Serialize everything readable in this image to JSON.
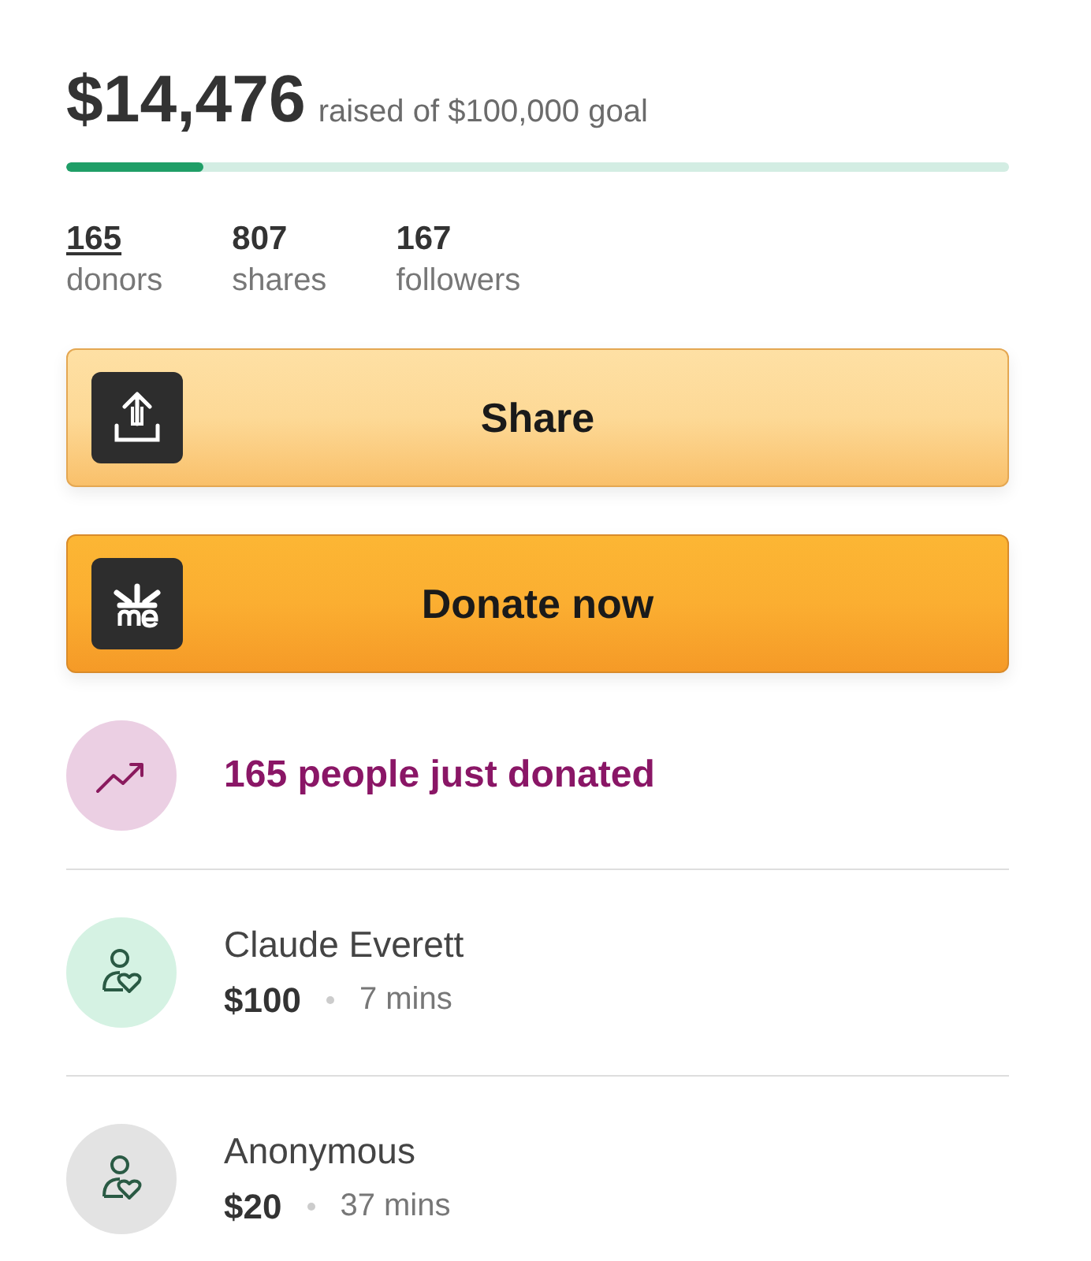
{
  "raised": {
    "amount": "$14,476",
    "caption": "raised of $100,000 goal",
    "level": 0.145
  },
  "stats": [
    {
      "value": "165",
      "label": "donors",
      "link": true
    },
    {
      "value": "807",
      "label": "shares",
      "link": false
    },
    {
      "value": "167",
      "label": "followers",
      "link": false
    }
  ],
  "buttons": [
    {
      "kind": "share",
      "label": "Share"
    },
    {
      "kind": "donate",
      "label": "Donate now"
    }
  ],
  "activity": {
    "text": "165 people just donated"
  },
  "donations": [
    {
      "name": "Claude Everett",
      "amount": "$100",
      "time": "7 mins",
      "color": "#d5f2e3"
    },
    {
      "name": "Anonymous",
      "amount": "$20",
      "time": "37 mins",
      "color": "#e3e3e3"
    }
  ]
}
